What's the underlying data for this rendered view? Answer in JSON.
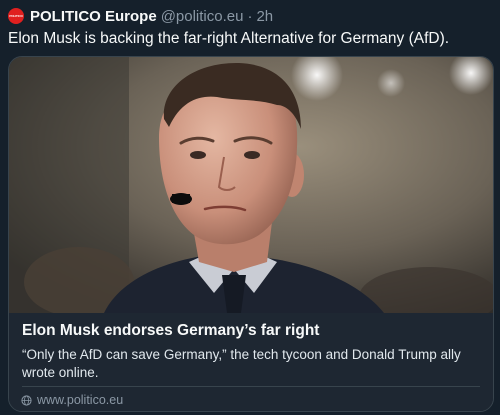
{
  "tweet": {
    "author": "POLITICO Europe",
    "handle": "@politico.eu",
    "separator": "·",
    "time": "2h",
    "avatar_text": "POLITICO",
    "text": "Elon Musk is backing the far-right Alternative for Germany (AfD)."
  },
  "card": {
    "title": "Elon Musk endorses Germany’s far right",
    "description": "“Only the AfD can save Germany,” the tech tycoon and Donald Trump ally wrote online.",
    "domain": "www.politico.eu",
    "domain_icon": "globe-icon"
  },
  "colors": {
    "background": "#15202b",
    "card_background": "#1e2732",
    "border": "#38444d",
    "secondary_text": "#8b98a5",
    "brand_red": "#e0201f"
  }
}
